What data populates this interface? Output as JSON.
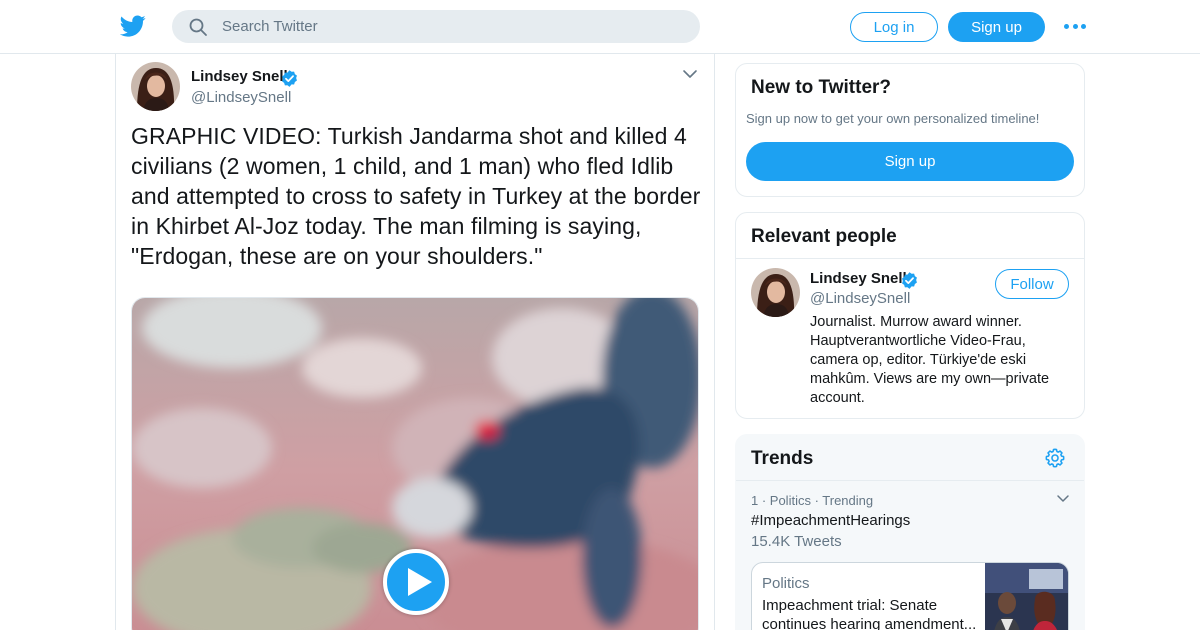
{
  "header": {
    "search_placeholder": "Search Twitter",
    "login_label": "Log in",
    "signup_label": "Sign up",
    "brand_color": "#1da1f2"
  },
  "tweet": {
    "author_name": "Lindsey Snell",
    "author_handle": "@LindseySnell",
    "verified": true,
    "text": "GRAPHIC VIDEO: Turkish Jandarma shot and killed 4 civilians (2 women, 1 child, and 1 man) who fled Idlib and attempted to cross to safety in Turkey at the border in Khirbet Al-Joz today. The man filming is saying, \"Erdogan, these are on your shoulders.\"",
    "media_type": "video"
  },
  "new_to_twitter": {
    "title": "New to Twitter?",
    "subtitle": "Sign up now to get your own personalized timeline!",
    "signup_label": "Sign up"
  },
  "relevant_people": {
    "title": "Relevant people",
    "person": {
      "name": "Lindsey Snell",
      "handle": "@LindseySnell",
      "follow_label": "Follow",
      "bio": "Journalist. Murrow award winner. Hauptverantwortliche Video-Frau, camera op, editor. Türkiye'de eski mahkûm. Views are my own—private account."
    }
  },
  "trends": {
    "title": "Trends",
    "items": [
      {
        "meta": "1 · Politics · Trending",
        "tag": "#ImpeachmentHearings",
        "count": "15.4K Tweets",
        "news_category": "Politics",
        "news_headline": "Impeachment trial: Senate continues hearing amendment..."
      }
    ]
  }
}
